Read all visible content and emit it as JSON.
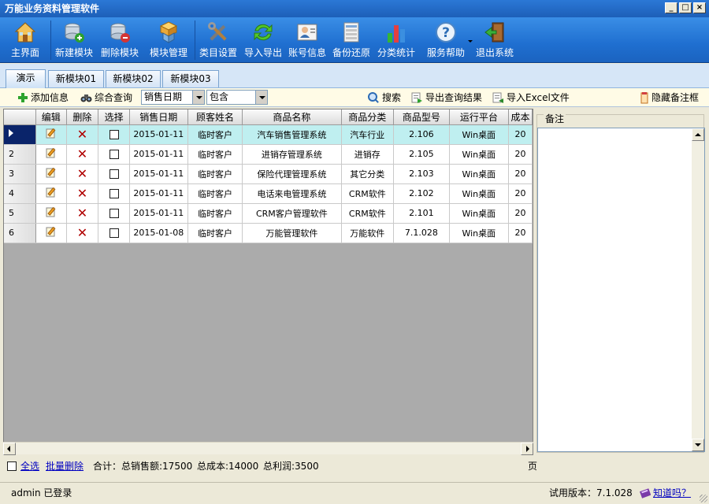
{
  "window": {
    "title": "万能业务资料管理软件",
    "controls": [
      "_",
      "□",
      "×"
    ]
  },
  "toolbar": {
    "items": [
      {
        "label": "主界面",
        "icon": "house-icon"
      },
      {
        "label": "新建模块",
        "icon": "add-module-icon"
      },
      {
        "label": "删除模块",
        "icon": "delete-module-icon"
      },
      {
        "label": "模块管理",
        "icon": "module-boxes-icon"
      },
      {
        "label": "类目设置",
        "icon": "tools-icon"
      },
      {
        "label": "导入导出",
        "icon": "sync-arrows-icon"
      },
      {
        "label": "账号信息",
        "icon": "user-card-icon"
      },
      {
        "label": "备份还原",
        "icon": "database-icon"
      },
      {
        "label": "分类统计",
        "icon": "bar-chart-icon"
      },
      {
        "label": "服务帮助",
        "icon": "help-icon"
      },
      {
        "label": "退出系统",
        "icon": "exit-door-icon"
      }
    ]
  },
  "tabs": [
    {
      "label": "演示",
      "active": true
    },
    {
      "label": "新模块01",
      "active": false
    },
    {
      "label": "新模块02",
      "active": false
    },
    {
      "label": "新模块03",
      "active": false
    }
  ],
  "actions": {
    "add": "添加信息",
    "query": "综合查询",
    "field_select": "销售日期",
    "op_select": "包含",
    "search": "搜索",
    "export": "导出查询结果",
    "import": "导入Excel文件",
    "hide_notes": "隐藏备注框"
  },
  "grid": {
    "columns": [
      "编辑",
      "删除",
      "选择",
      "销售日期",
      "顾客姓名",
      "商品名称",
      "商品分类",
      "商品型号",
      "运行平台",
      "成本"
    ],
    "rows": [
      {
        "no": "",
        "date": "2015-01-11",
        "customer": "临时客户",
        "product": "汽车销售管理系统",
        "category": "汽车行业",
        "model": "2.106",
        "platform": "Win桌面",
        "cost": "20"
      },
      {
        "no": "2",
        "date": "2015-01-11",
        "customer": "临时客户",
        "product": "进销存管理系统",
        "category": "进销存",
        "model": "2.105",
        "platform": "Win桌面",
        "cost": "20"
      },
      {
        "no": "3",
        "date": "2015-01-11",
        "customer": "临时客户",
        "product": "保险代理管理系统",
        "category": "其它分类",
        "model": "2.103",
        "platform": "Win桌面",
        "cost": "20"
      },
      {
        "no": "4",
        "date": "2015-01-11",
        "customer": "临时客户",
        "product": "电话来电管理系统",
        "category": "CRM软件",
        "model": "2.102",
        "platform": "Win桌面",
        "cost": "20"
      },
      {
        "no": "5",
        "date": "2015-01-11",
        "customer": "临时客户",
        "product": "CRM客户管理软件",
        "category": "CRM软件",
        "model": "2.101",
        "platform": "Win桌面",
        "cost": "20"
      },
      {
        "no": "6",
        "date": "2015-01-08",
        "customer": "临时客户",
        "product": "万能管理软件",
        "category": "万能软件",
        "model": "7.1.028",
        "platform": "Win桌面",
        "cost": "20"
      }
    ]
  },
  "notes": {
    "label": "备注"
  },
  "footer": {
    "select_all": "全选",
    "batch_delete": "批量删除",
    "summary_label": "合计：",
    "total_sales": "总销售额:17500",
    "total_cost": "总成本:14000",
    "total_profit": "总利润:3500",
    "page": "页"
  },
  "status": {
    "user": "admin 已登录",
    "version": "试用版本：7.1.028",
    "help_link": "知道吗？"
  },
  "colors": {
    "toolbar_blue": "#1f6fd0",
    "selected_row": "#bfeff0",
    "delete_red": "#b00000"
  }
}
